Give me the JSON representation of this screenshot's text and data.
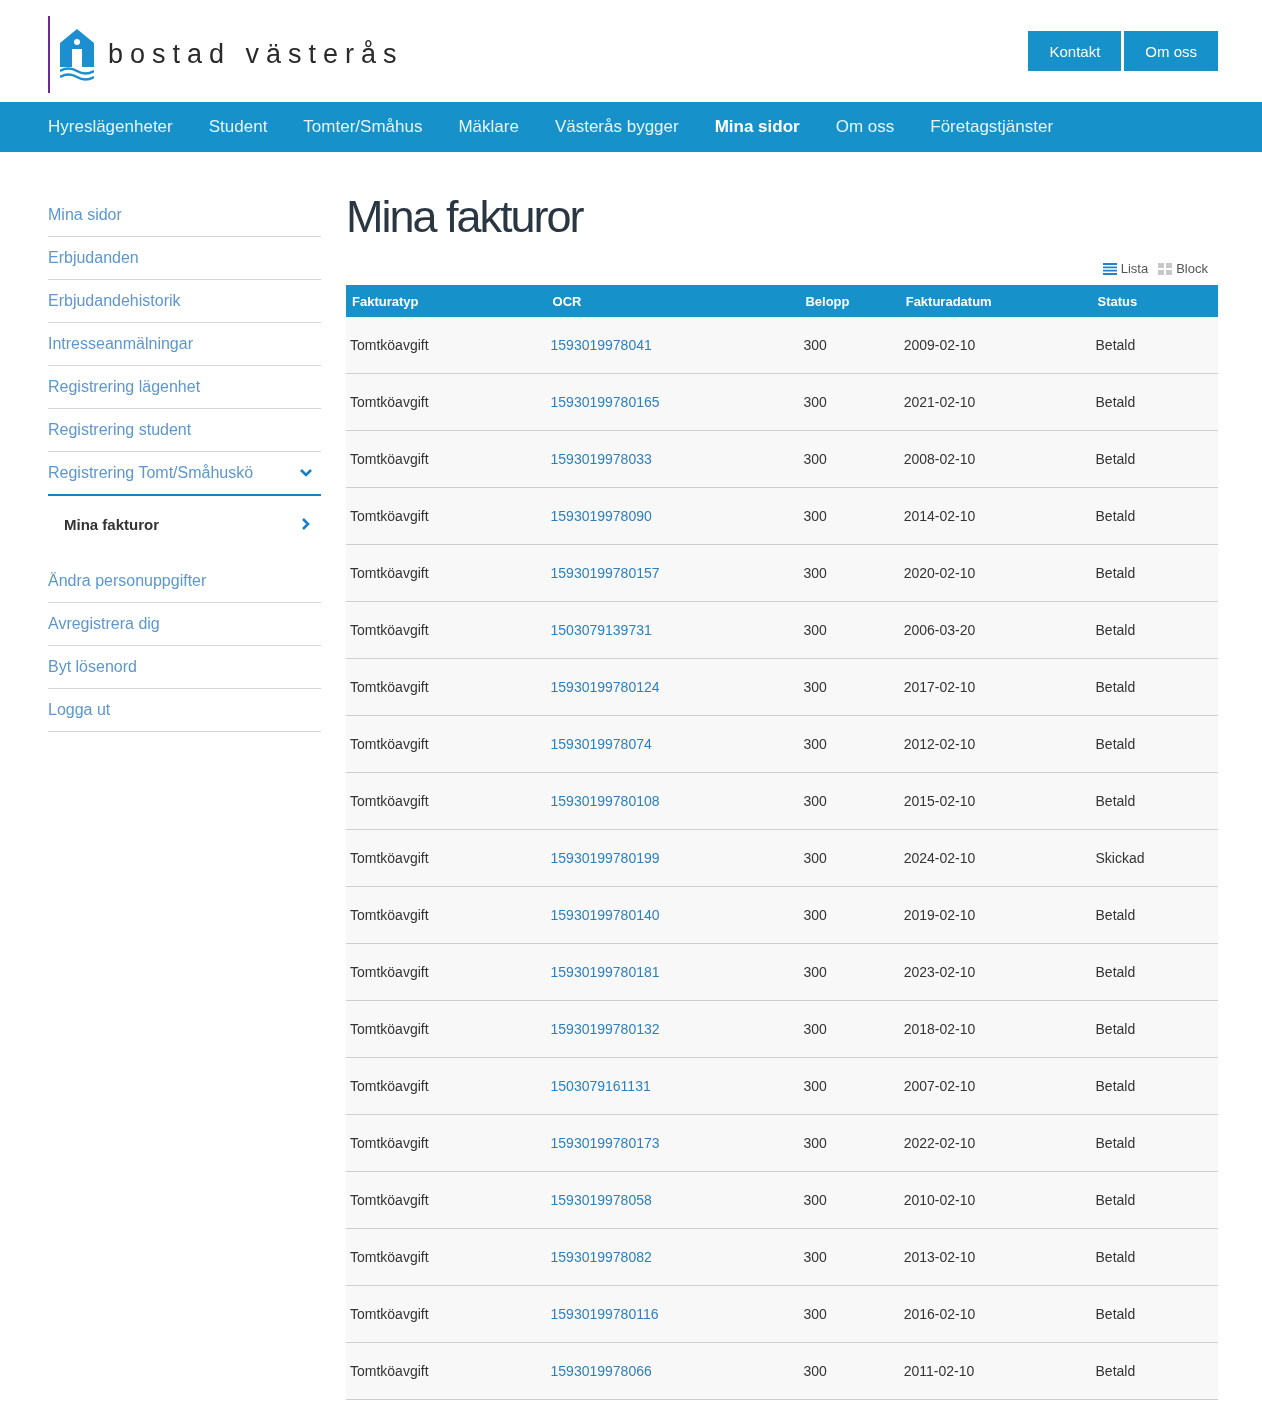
{
  "header": {
    "logo_text": "bostad västerås",
    "buttons": [
      "Kontakt",
      "Om oss"
    ]
  },
  "nav": [
    {
      "label": "Hyreslägenheter",
      "selected": false
    },
    {
      "label": "Student",
      "selected": false
    },
    {
      "label": "Tomter/Småhus",
      "selected": false
    },
    {
      "label": "Mäklare",
      "selected": false
    },
    {
      "label": "Västerås bygger",
      "selected": false
    },
    {
      "label": "Mina sidor",
      "selected": true
    },
    {
      "label": "Om oss",
      "selected": false
    },
    {
      "label": "Företagstjänster",
      "selected": false
    }
  ],
  "sidebar": [
    {
      "label": "Mina sidor",
      "selected": false
    },
    {
      "label": "Erbjudanden",
      "selected": false
    },
    {
      "label": "Erbjudandehistorik",
      "selected": false
    },
    {
      "label": "Intresseanmälningar",
      "selected": false
    },
    {
      "label": "Registrering lägenhet",
      "selected": false
    },
    {
      "label": "Registrering student",
      "selected": false
    },
    {
      "label": "Registrering Tomt/Småhuskö",
      "selected": false,
      "expanded": true,
      "children": [
        {
          "label": "Mina fakturor",
          "selected": true
        }
      ]
    },
    {
      "label": "Ändra personuppgifter",
      "selected": false
    },
    {
      "label": "Avregistrera dig",
      "selected": false
    },
    {
      "label": "Byt lösenord",
      "selected": false
    },
    {
      "label": "Logga ut",
      "selected": false
    }
  ],
  "page_title": "Mina fakturor",
  "view_toggle": [
    {
      "kind": "list",
      "label": "Lista",
      "selected": true
    },
    {
      "kind": "block",
      "label": "Block",
      "selected": false
    }
  ],
  "table": {
    "columns": [
      "Fakturatyp",
      "OCR",
      "Belopp",
      "Fakturadatum",
      "Status"
    ],
    "rows": [
      [
        "Tomtköavgift",
        "1593019978041",
        "300",
        "2009-02-10",
        "Betald"
      ],
      [
        "Tomtköavgift",
        "15930199780165",
        "300",
        "2021-02-10",
        "Betald"
      ],
      [
        "Tomtköavgift",
        "1593019978033",
        "300",
        "2008-02-10",
        "Betald"
      ],
      [
        "Tomtköavgift",
        "1593019978090",
        "300",
        "2014-02-10",
        "Betald"
      ],
      [
        "Tomtköavgift",
        "15930199780157",
        "300",
        "2020-02-10",
        "Betald"
      ],
      [
        "Tomtköavgift",
        "1503079139731",
        "300",
        "2006-03-20",
        "Betald"
      ],
      [
        "Tomtköavgift",
        "15930199780124",
        "300",
        "2017-02-10",
        "Betald"
      ],
      [
        "Tomtköavgift",
        "1593019978074",
        "300",
        "2012-02-10",
        "Betald"
      ],
      [
        "Tomtköavgift",
        "15930199780108",
        "300",
        "2015-02-10",
        "Betald"
      ],
      [
        "Tomtköavgift",
        "15930199780199",
        "300",
        "2024-02-10",
        "Skickad"
      ],
      [
        "Tomtköavgift",
        "15930199780140",
        "300",
        "2019-02-10",
        "Betald"
      ],
      [
        "Tomtköavgift",
        "15930199780181",
        "300",
        "2023-02-10",
        "Betald"
      ],
      [
        "Tomtköavgift",
        "15930199780132",
        "300",
        "2018-02-10",
        "Betald"
      ],
      [
        "Tomtköavgift",
        "1503079161131",
        "300",
        "2007-02-10",
        "Betald"
      ],
      [
        "Tomtköavgift",
        "15930199780173",
        "300",
        "2022-02-10",
        "Betald"
      ],
      [
        "Tomtköavgift",
        "1593019978058",
        "300",
        "2010-02-10",
        "Betald"
      ],
      [
        "Tomtköavgift",
        "1593019978082",
        "300",
        "2013-02-10",
        "Betald"
      ],
      [
        "Tomtköavgift",
        "15930199780116",
        "300",
        "2016-02-10",
        "Betald"
      ],
      [
        "Tomtköavgift",
        "1593019978066",
        "300",
        "2011-02-10",
        "Betald"
      ]
    ]
  }
}
